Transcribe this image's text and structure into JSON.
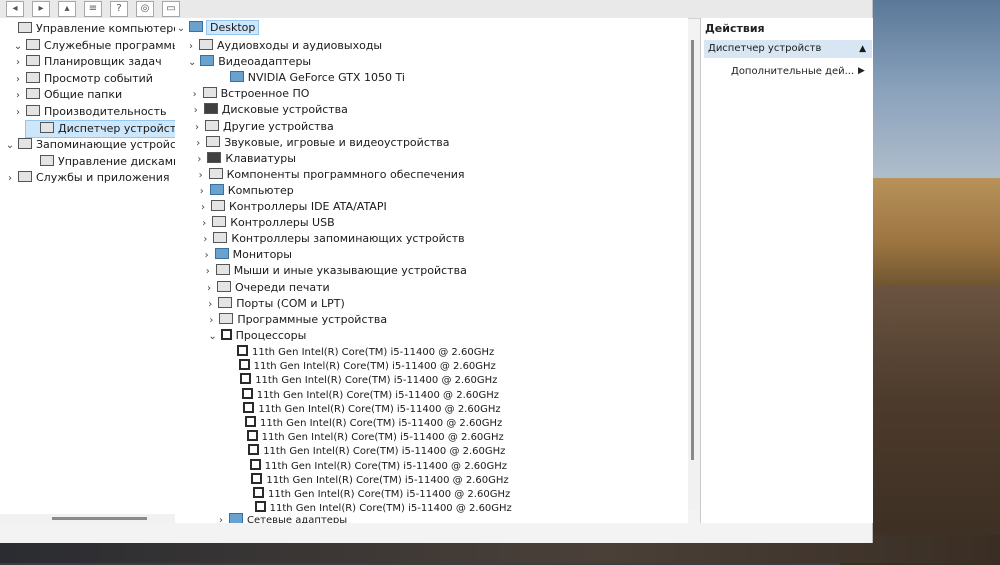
{
  "left_tree": [
    {
      "label": "Управление компьютером (л",
      "icon": "computer-management-icon",
      "chev": ""
    },
    {
      "label": "Служебные программы",
      "icon": "tools-icon",
      "chev": "⌄"
    },
    {
      "label": "Планировщик задач",
      "icon": "clock-icon",
      "chev": "›"
    },
    {
      "label": "Просмотр событий",
      "icon": "event-viewer-icon",
      "chev": "›"
    },
    {
      "label": "Общие папки",
      "icon": "shared-folder-icon",
      "chev": "›"
    },
    {
      "label": "Производительность",
      "icon": "performance-icon",
      "chev": "›"
    },
    {
      "label": "Диспетчер устройств",
      "icon": "device-manager-icon",
      "chev": ""
    },
    {
      "label": "Запоминающие устройст",
      "icon": "storage-icon",
      "chev": "⌄"
    },
    {
      "label": "Управление дисками",
      "icon": "disk-management-icon",
      "chev": ""
    },
    {
      "label": "Службы и приложения",
      "icon": "services-icon",
      "chev": "›"
    }
  ],
  "device_tree": {
    "root": "Desktop",
    "items": [
      "Аудиовходы и аудиовыходы",
      "Видеоадаптеры",
      "NVIDIA GeForce GTX 1050 Ti",
      "Встроенное ПО",
      "Дисковые устройства",
      "Другие устройства",
      "Звуковые, игровые и видеоустройства",
      "Клавиатуры",
      "Компоненты программного обеспечения",
      "Компьютер",
      "Контроллеры IDE ATA/ATAPI",
      "Контроллеры USB",
      "Контроллеры запоминающих устройств",
      "Мониторы",
      "Мыши и иные указывающие устройства",
      "Очереди печати",
      "Порты (COM и LPT)",
      "Программные устройства",
      "Процессоры"
    ],
    "processor_label": "11th Gen Intel(R) Core(TM) i5-11400 @ 2.60GHz",
    "processor_count": 12,
    "last_item": "Сетевые адаптеры"
  },
  "actions": {
    "header": "Действия",
    "selected": "Диспетчер устройств",
    "more": "Дополнительные дей..."
  }
}
